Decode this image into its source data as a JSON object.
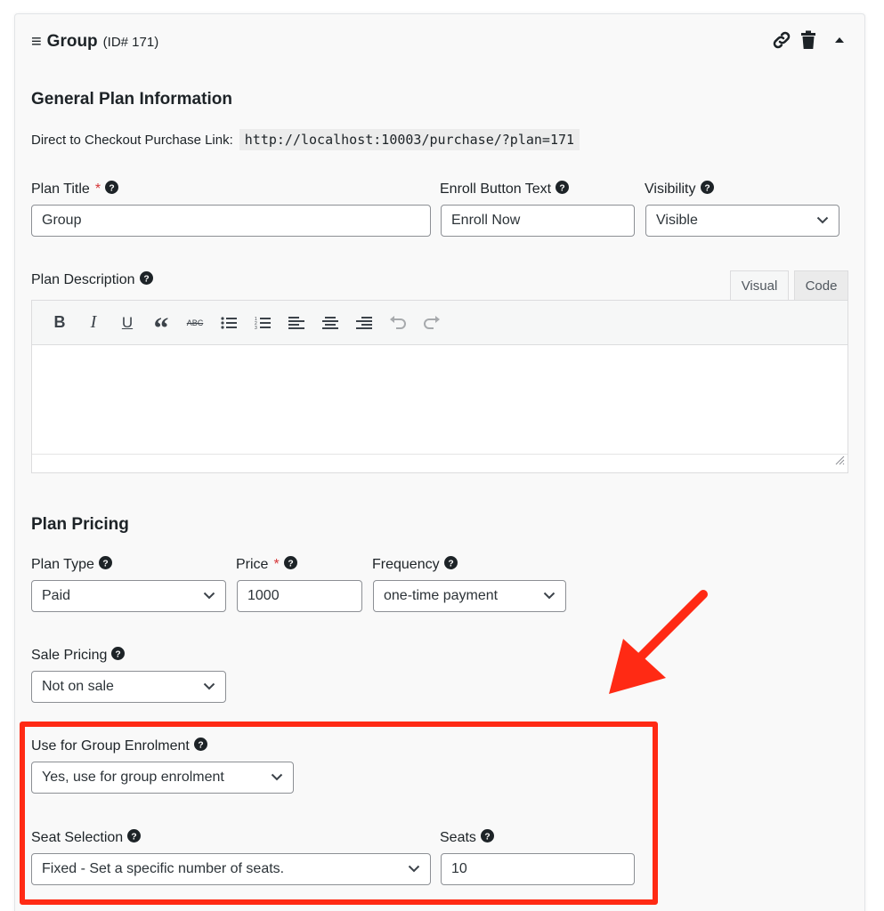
{
  "header": {
    "title": "Group",
    "id_label": "(ID# 171)"
  },
  "general": {
    "heading": "General Plan Information",
    "checkout_label": "Direct to Checkout Purchase Link:",
    "checkout_url": "http://localhost:10003/purchase/?plan=171",
    "plan_title_label": "Plan Title",
    "plan_title_required": "*",
    "plan_title_value": "Group",
    "enroll_label": "Enroll Button Text",
    "enroll_value": "Enroll Now",
    "visibility_label": "Visibility",
    "visibility_value": "Visible",
    "description_label": "Plan Description",
    "tab_visual": "Visual",
    "tab_code": "Code"
  },
  "toolbar": {
    "bold": "B",
    "italic": "I",
    "underline": "U",
    "blockquote": "“",
    "strikethrough": "ABC"
  },
  "pricing": {
    "heading": "Plan Pricing",
    "plan_type_label": "Plan Type",
    "plan_type_value": "Paid",
    "price_label": "Price",
    "price_required": "*",
    "price_value": "1000",
    "frequency_label": "Frequency",
    "frequency_value": "one-time payment",
    "sale_label": "Sale Pricing",
    "sale_value": "Not on sale"
  },
  "group": {
    "use_label": "Use for Group Enrolment",
    "use_value": "Yes, use for group enrolment",
    "seat_label": "Seat Selection",
    "seat_value": "Fixed - Set a specific number of seats.",
    "seats_label": "Seats",
    "seats_value": "10"
  },
  "colors": {
    "annotation": "#ff2a14",
    "required": "#d63638"
  }
}
